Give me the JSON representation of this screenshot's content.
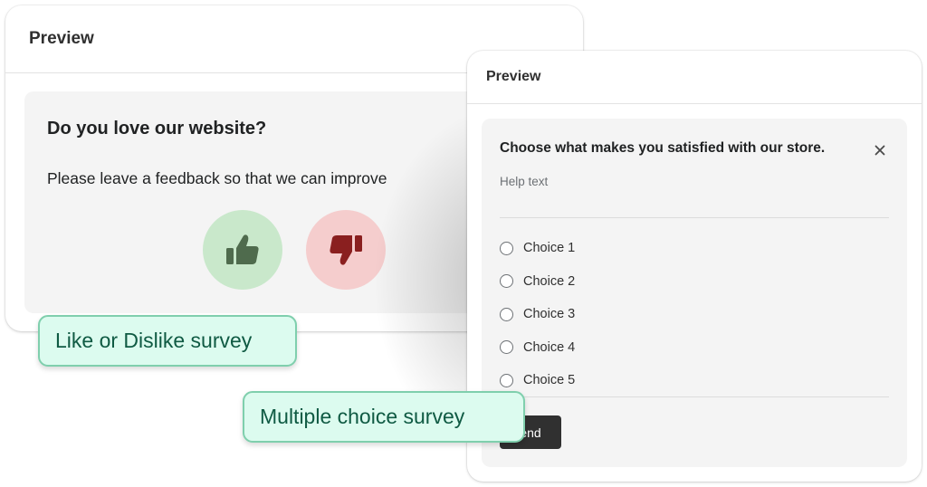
{
  "like_card": {
    "title": "Preview",
    "question": "Do you love our website?",
    "subtext": "Please leave a feedback so that we can improve",
    "like_icon": "thumbs-up-icon",
    "dislike_icon": "thumbs-down-icon"
  },
  "choice_card": {
    "title": "Preview",
    "question": "Choose what makes you satisfied with our store.",
    "help_text": "Help text",
    "close_icon": "close-icon",
    "choices": [
      "Choice 1",
      "Choice 2",
      "Choice 3",
      "Choice 4",
      "Choice 5"
    ],
    "send_label": "end"
  },
  "labels": {
    "like_dislike": "Like or Dislike survey",
    "multiple_choice": "Multiple choice survey"
  },
  "colors": {
    "like_bg": "#c9e8cb",
    "like_icon": "#4f6b4d",
    "dislike_bg": "#f5cdcd",
    "dislike_icon": "#8a1f1f",
    "tag_bg": "#dcfbef",
    "tag_border": "#7fcfad",
    "tag_text": "#0f5a43",
    "send_bg": "#303030"
  }
}
